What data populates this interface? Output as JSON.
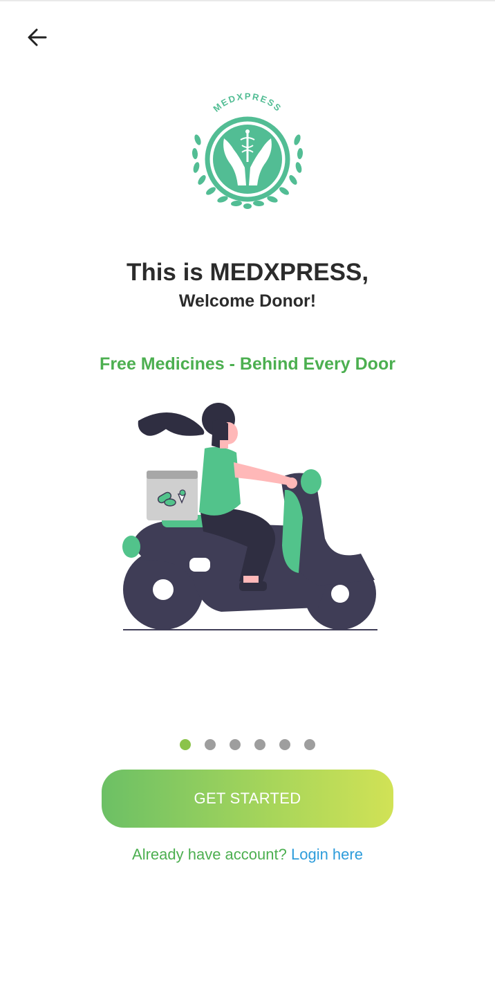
{
  "header": {
    "back_icon": "arrow-left-icon"
  },
  "logo": {
    "text": "MEDXPRESS",
    "color": "#52bd94"
  },
  "welcome": {
    "title": "This is MEDXPRESS,",
    "subtitle": "Welcome Donor!"
  },
  "slide": {
    "tagline": "Free Medicines - Behind Every Door",
    "illustration": "delivery-scooter-illustration"
  },
  "pagination": {
    "total": 6,
    "active_index": 0
  },
  "actions": {
    "get_started_label": "GET STARTED",
    "login_prompt": "Already have account?",
    "login_link": "Login here"
  },
  "colors": {
    "accent_green": "#4caf50",
    "link_blue": "#2d9cdb",
    "dot_active": "#8bc34a",
    "dot_inactive": "#9e9e9e",
    "button_gradient_start": "#6cc065",
    "button_gradient_end": "#d1e256"
  }
}
